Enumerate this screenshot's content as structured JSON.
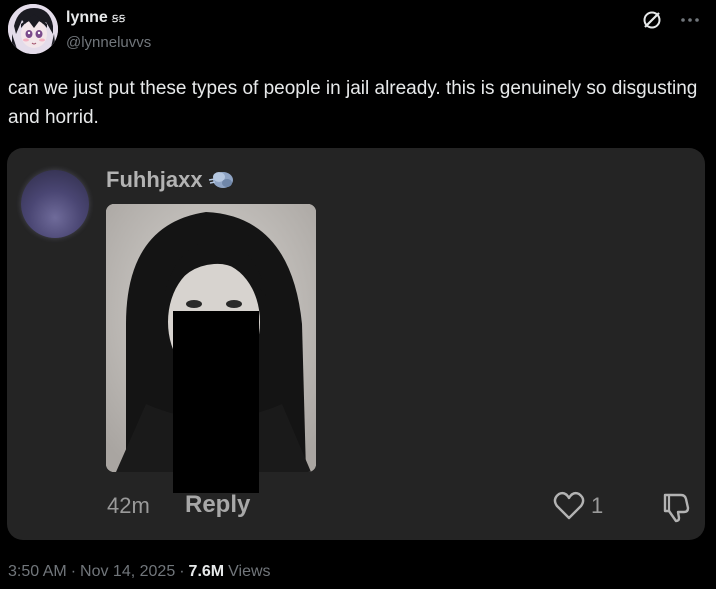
{
  "author": {
    "display_name": "lynne",
    "name_glyph": "ꞩꞩ",
    "handle": "@lynneluvvs"
  },
  "tweet": {
    "text": "can we just put these types of people in jail already. this is genuinely so disgusting and horrid."
  },
  "embedded_comment": {
    "username": "Fuhhjaxx",
    "time_ago": "42m",
    "reply_label": "Reply",
    "like_count": "1"
  },
  "meta": {
    "time": "3:50 AM",
    "sep1": "·",
    "date": "Nov 14, 2025",
    "sep2": "·",
    "views_count": "7.6M",
    "views_label": "Views"
  },
  "icons": {
    "grok": "grok-icon",
    "more": "more-icon",
    "comment_badge": "cloud-puff-icon",
    "like": "heart-icon",
    "dislike": "thumbs-down-icon"
  },
  "colors": {
    "background": "#000000",
    "card": "#242424",
    "text": "#e7e9ea",
    "muted": "#71767b"
  }
}
